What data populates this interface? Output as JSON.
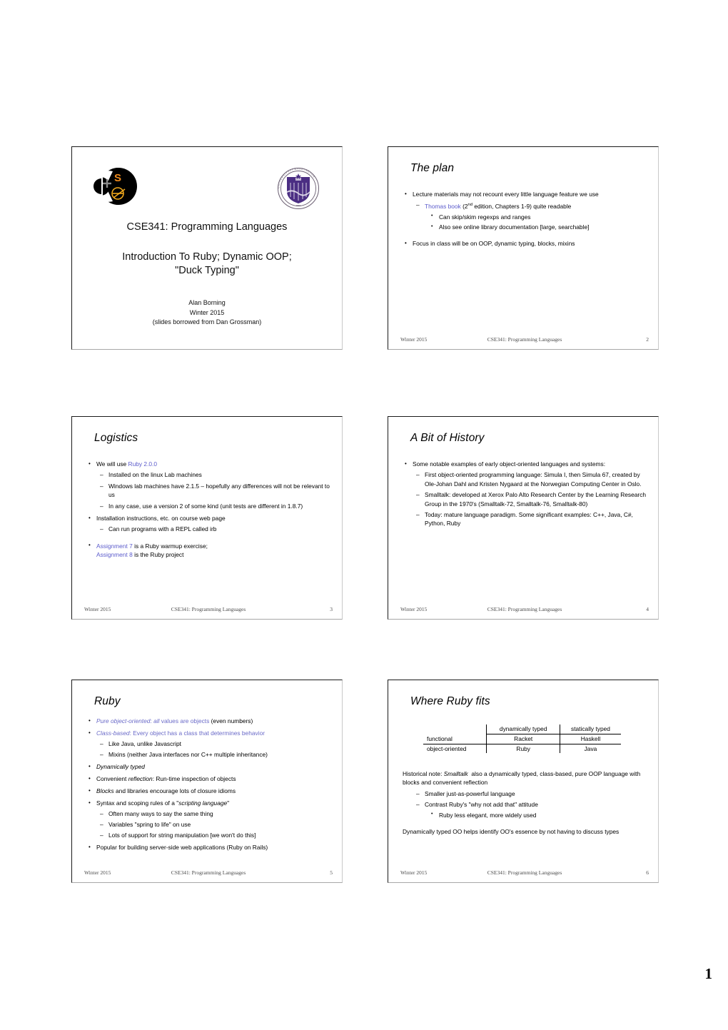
{
  "page_number": "1",
  "footer_common": {
    "term": "Winter 2015",
    "course": "CSE341: Programming Languages"
  },
  "slides": [
    {
      "index": "1",
      "kind": "title",
      "title_line": "CSE341: Programming Languages",
      "subtitle_line1": "Introduction To Ruby; Dynamic OOP;",
      "subtitle_line2": "\"Duck Typing\"",
      "author": "Alan Borning",
      "term": "Winter 2015",
      "credit": "(slides borrowed from Dan Grossman)",
      "logos": {
        "cse": "cse-logo",
        "uw": "uw-seal"
      }
    },
    {
      "index": "2",
      "title": "The plan",
      "footer_num": "2",
      "bullets": [
        {
          "level": 1,
          "text": "Lecture materials may not recount every little language feature we use"
        },
        {
          "level": 2,
          "html": "<span class=\"lnk\">Thomas book</span> (2<sup>nd</sup> edition, Chapters 1-9) quite readable"
        },
        {
          "level": 3,
          "text": "Can skip/skim regexps and ranges"
        },
        {
          "level": 3,
          "text": "Also see online library documentation [large, searchable]"
        },
        {
          "level": 1,
          "text": "Focus in class will be on OOP, dynamic typing, blocks, mixins",
          "gap": true
        }
      ]
    },
    {
      "index": "3",
      "title": "Logistics",
      "footer_num": "3",
      "bullets": [
        {
          "level": 1,
          "html": "We will use <span class=\"lnk\">Ruby 2.0.0</span>"
        },
        {
          "level": 2,
          "text": "Installed on the linux Lab machines"
        },
        {
          "level": 2,
          "text": "Windows lab machines have 2.1.5 – hopefully any differences will not be relevant to us"
        },
        {
          "level": 2,
          "text": "In any case, use a version 2 of some kind (unit tests are different in 1.8.7)"
        },
        {
          "level": 1,
          "text": "Installation instructions, etc. on course web page"
        },
        {
          "level": 2,
          "text": "Can run programs with a REPL called irb"
        },
        {
          "level": 1,
          "html": "<span class=\"lnk\">Assignment 7</span> is a Ruby warmup exercise;<br><span class=\"lnk\">Assignment 8</span> is the Ruby project",
          "gap": true
        }
      ]
    },
    {
      "index": "4",
      "title": "A Bit of History",
      "footer_num": "4",
      "bullets": [
        {
          "level": 1,
          "text": "Some notable examples of early object-oriented languages and systems:"
        },
        {
          "level": 2,
          "text": "First object-oriented programming language: Simula I, then Simula 67, created by Ole-Johan Dahl and Kristen Nygaard at the Norwegian Computing Center in Oslo."
        },
        {
          "level": 2,
          "text": "Smalltalk: developed at Xerox Palo Alto Research Center by the Learning Research Group in the 1970's (Smalltalk-72, Smalltalk-76, Smalltalk-80)"
        },
        {
          "level": 2,
          "text": "Today: mature language paradigm.  Some significant examples: C++, Java, C#, Python, Ruby"
        }
      ]
    },
    {
      "index": "5",
      "title": "Ruby",
      "footer_num": "5",
      "bullets": [
        {
          "level": 1,
          "html": "<span class=\"blu\"><span class=\"it\">Pure object-oriented</span>: <span class=\"it\">all</span> values are objects</span> (even numbers)"
        },
        {
          "level": 1,
          "html": "<span class=\"blu\"><span class=\"it\">Class-based</span>: Every object has a class that determines behavior</span>"
        },
        {
          "level": 2,
          "text": "Like Java, unlike Javascript"
        },
        {
          "level": 2,
          "text": "Mixins (neither Java interfaces nor C++ multiple inheritance)"
        },
        {
          "level": 1,
          "html": "<span class=\"it\">Dynamically typed</span>"
        },
        {
          "level": 1,
          "html": "Convenient <span class=\"it\">reflection</span>: Run-time inspection of objects"
        },
        {
          "level": 1,
          "html": "<span class=\"it\">Blocks</span> and libraries encourage lots of closure idioms"
        },
        {
          "level": 1,
          "html": "Syntax and scoping rules of a \"<span class=\"it\">scripting language</span>\""
        },
        {
          "level": 2,
          "text": "Often many ways to say the same thing"
        },
        {
          "level": 2,
          "text": "Variables \"spring to life\" on use"
        },
        {
          "level": 2,
          "text": "Lots of support for string manipulation [we won't do this]"
        },
        {
          "level": 1,
          "text": "Popular for building server-side web applications (Ruby on Rails)"
        }
      ]
    },
    {
      "index": "6",
      "title": "Where Ruby fits",
      "footer_num": "6",
      "table": {
        "corner": "",
        "columns": [
          "dynamically typed",
          "statically typed"
        ],
        "rows": [
          {
            "label": "functional",
            "cells": [
              "Racket",
              "Haskell"
            ]
          },
          {
            "label": "object-oriented",
            "cells": [
              "Ruby",
              "Java"
            ]
          }
        ]
      },
      "notes": [
        {
          "level": 0,
          "html": "Historical note: <span class=\"it\">Smalltalk</span>&nbsp; also a dynamically typed, class-based, pure OOP language with blocks and convenient reflection"
        },
        {
          "level": 2,
          "text": "Smaller just-as-powerful language"
        },
        {
          "level": 2,
          "text": "Contrast Ruby's \"why not add that\" attitude"
        },
        {
          "level": 3,
          "text": "Ruby less elegant, more widely used"
        },
        {
          "level": 0,
          "text": "Dynamically typed OO helps identify OO's essence by not having to discuss types",
          "gap": true
        }
      ]
    }
  ]
}
